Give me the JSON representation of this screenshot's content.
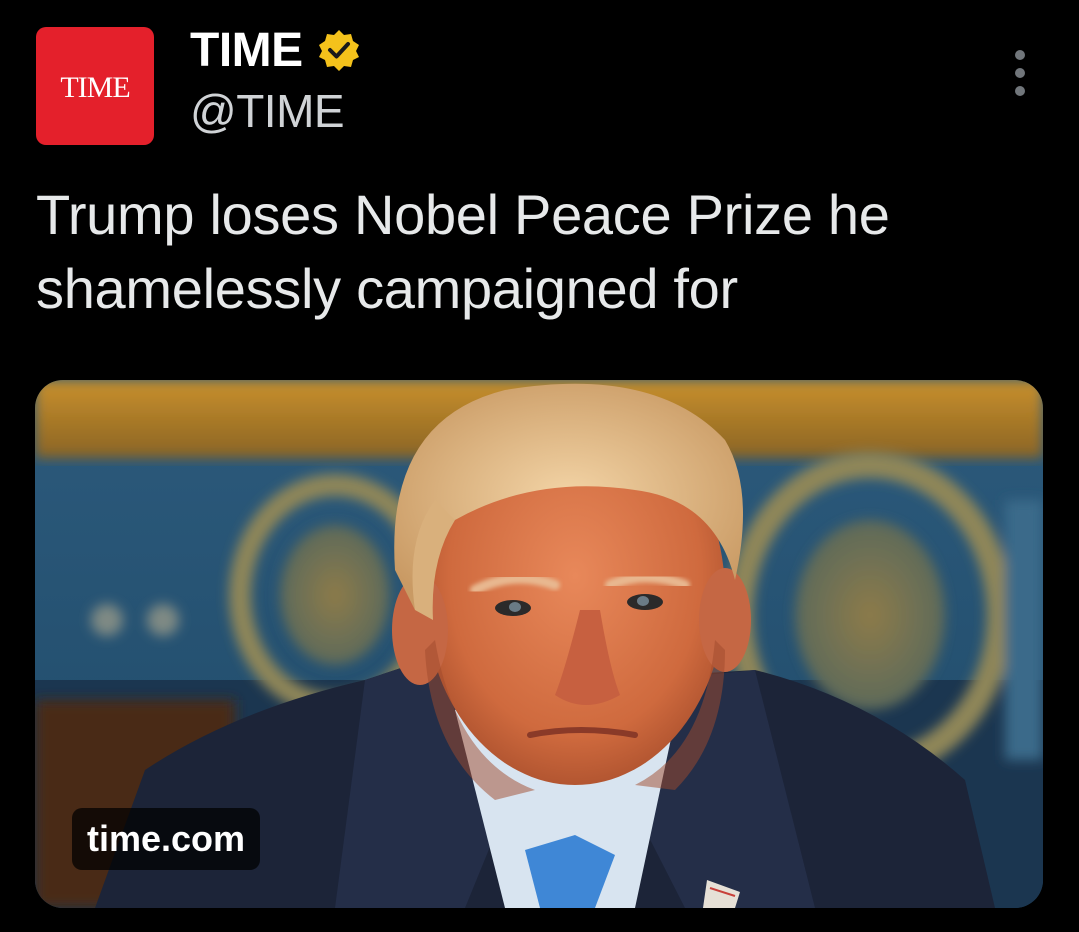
{
  "account": {
    "avatar_text": "TIME",
    "display_name": "TIME",
    "handle": "@TIME",
    "verified_badge_color": "#f4c21b",
    "avatar_color": "#e4202b"
  },
  "post": {
    "text": "Trump loses Nobel Peace Prize he shamelessly campaigned for"
  },
  "link_card": {
    "domain": "time.com",
    "image_icon": "photo-of-man-in-suit"
  },
  "menu": {
    "icon": "more-vertical-icon"
  }
}
